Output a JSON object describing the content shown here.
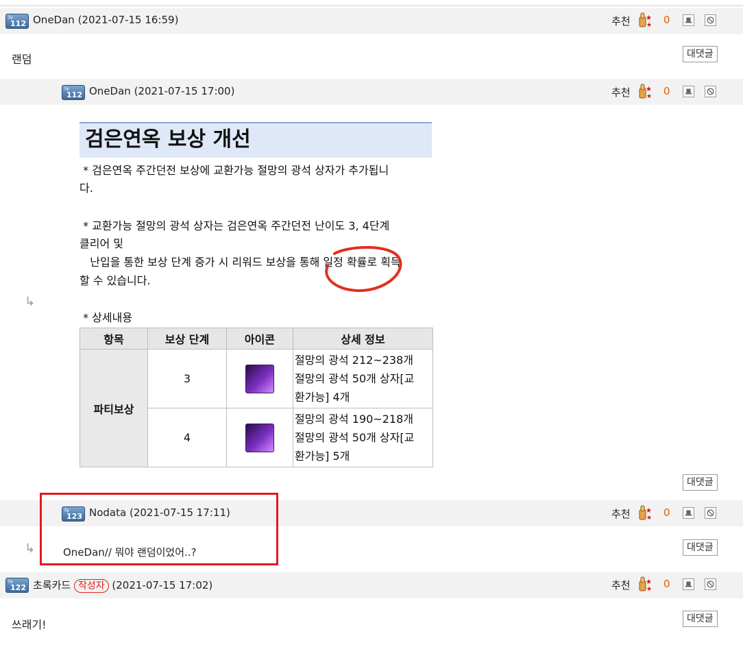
{
  "comments": [
    {
      "level": "112",
      "author": "OneDan",
      "datetime": "(2021-07-15 16:59)",
      "vote_label": "추천",
      "vote_count": "0",
      "body": "랜덤",
      "reply_label": "대댓글"
    },
    {
      "level": "112",
      "author": "OneDan",
      "datetime": "(2021-07-15 17:00)",
      "vote_label": "추천",
      "vote_count": "0",
      "reply_label": "대댓글"
    },
    {
      "level": "123",
      "author": "Nodata",
      "datetime": "(2021-07-15 17:11)",
      "vote_label": "추천",
      "vote_count": "0",
      "body": "OneDan// 뭐야 랜덤이었어..?",
      "reply_label": "대댓글"
    },
    {
      "level": "122",
      "author": "초록카드",
      "badge": "작성자",
      "datetime": "(2021-07-15 17:02)",
      "vote_label": "추천",
      "vote_count": "0",
      "body": "쓰래기!",
      "reply_label": "대댓글"
    }
  ],
  "reply_arrow": "↳",
  "notice": {
    "title": "검은연옥 보상 개선",
    "p1_line1": " * 검은연옥 주간던전 보상에 교환가능 절망의 광석 상자가 추가됩니",
    "p1_line2": "다.",
    "p2_line1": " * 교환가능 절망의 광석 상자는 검은연옥 주간던전 난이도 3, 4단계",
    "p2_line2": "클리어 및",
    "p2_line3": "   난입을 통한 보상 단계 증가 시 리워드 보상을 통해 일정 확률로 획득",
    "p2_line4": "할 수 있습니다.",
    "detail_label": " * 상세내용",
    "table": {
      "headers": [
        "항목",
        "보상 단계",
        "아이콘",
        "상세 정보"
      ],
      "group": "파티보상",
      "rows": [
        {
          "stage": "3",
          "detail1": "절망의 광석 212~238개",
          "detail2": "절망의 광석 50개 상자[교",
          "detail3": "환가능] 4개"
        },
        {
          "stage": "4",
          "detail1": "절망의 광석 190~218개",
          "detail2": "절망의 광석 50개 상자[교",
          "detail3": "환가능] 5개"
        }
      ]
    }
  },
  "colors": {
    "accent_orange": "#e85a00",
    "highlight_red": "#e0191f",
    "header_bg": "#f2f2f2"
  }
}
